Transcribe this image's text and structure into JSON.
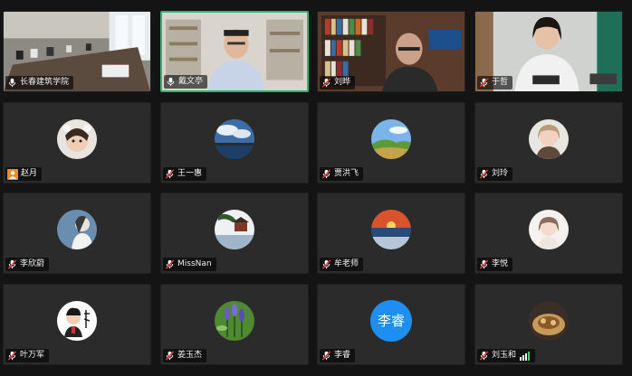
{
  "participants": [
    {
      "name": "长春建筑学院",
      "kind": "video",
      "scene": "conference-room",
      "mic": "on"
    },
    {
      "name": "戴文亭",
      "kind": "video",
      "scene": "office-man",
      "mic": "on",
      "active": true
    },
    {
      "name": "刘晔",
      "kind": "video",
      "scene": "bookshelf-man",
      "mic": "muted"
    },
    {
      "name": "于哲",
      "kind": "video",
      "scene": "home-woman",
      "mic": "muted"
    },
    {
      "name": "赵月",
      "kind": "avatar",
      "avatar": "child-photo",
      "mic": "user"
    },
    {
      "name": "王一惠",
      "kind": "avatar",
      "avatar": "sky-lake",
      "mic": "muted"
    },
    {
      "name": "贾洪飞",
      "kind": "avatar",
      "avatar": "green-hills",
      "mic": "muted"
    },
    {
      "name": "刘玲",
      "kind": "avatar",
      "avatar": "woman-photo",
      "mic": "muted"
    },
    {
      "name": "李欣蔚",
      "kind": "avatar",
      "avatar": "woman-profile",
      "mic": "muted"
    },
    {
      "name": "MissNan",
      "kind": "avatar",
      "avatar": "pavilion-tree",
      "mic": "muted"
    },
    {
      "name": "牟老师",
      "kind": "avatar",
      "avatar": "sunset-sea",
      "mic": "muted"
    },
    {
      "name": "李悦",
      "kind": "avatar",
      "avatar": "pale-portrait",
      "mic": "muted"
    },
    {
      "name": "叶万军",
      "kind": "avatar",
      "avatar": "cartoon-man",
      "mic": "muted"
    },
    {
      "name": "姜玉杰",
      "kind": "avatar",
      "avatar": "lavender",
      "mic": "muted"
    },
    {
      "name": "李睿",
      "kind": "text-avatar",
      "avatar_text": "李睿",
      "mic": "muted"
    },
    {
      "name": "刘玉和",
      "kind": "avatar",
      "avatar": "food-plate",
      "mic": "muted",
      "signal": true
    }
  ],
  "colors": {
    "background": "#141414",
    "tile": "#2b2b2b",
    "active_border": "#2bb673",
    "muted_red": "#e03a3a",
    "text_avatar_blue": "#1f8ef1",
    "user_icon_orange": "#f08a24"
  }
}
